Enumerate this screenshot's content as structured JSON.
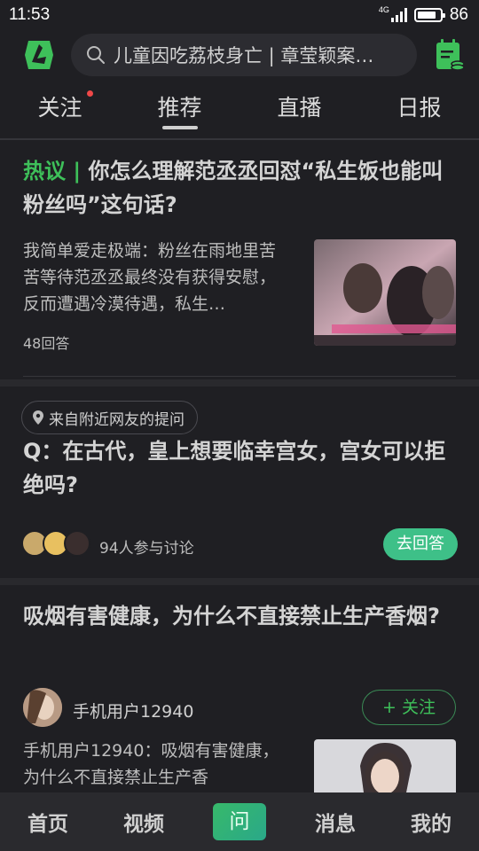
{
  "status_bar": {
    "time": "11:53",
    "network": "4G",
    "battery": "86",
    "battery_level": 0.86
  },
  "header": {
    "search_text": "儿童因吃荔枝身亡 | 章莹颖案…",
    "logo_icon": "app-logo-icon",
    "calendar_icon": "daily-calendar-icon"
  },
  "tabs": [
    {
      "label": "关注",
      "has_dot": true
    },
    {
      "label": "推荐",
      "active": true
    },
    {
      "label": "直播"
    },
    {
      "label": "日报"
    }
  ],
  "feed": {
    "card1": {
      "tag": "热议 | ",
      "title": "你怎么理解范丞丞回怼“私生饭也能叫粉丝吗”这句话?",
      "excerpt": "我简单爱走极端：粉丝在雨地里苦苦等待范丞丞最终没有获得安慰，反而遭遇冷漠待遇，私生…",
      "answers": "48回答"
    },
    "card2": {
      "location": "来自附近网友的提问",
      "title": "Q：在古代，皇上想要临幸宫女，宫女可以拒绝吗?",
      "participants": "94人参与讨论",
      "answer_button": "去回答"
    },
    "card3": {
      "title": "吸烟有害健康，为什么不直接禁止生产香烟?",
      "username": "手机用户12940",
      "follow_button": "+ 关注",
      "excerpt": "手机用户12940：吸烟有害健康，为什么不直接禁止生产香"
    }
  },
  "bottom_nav": [
    {
      "label": "首页"
    },
    {
      "label": "视频"
    },
    {
      "label": "问",
      "active": true
    },
    {
      "label": "消息"
    },
    {
      "label": "我的"
    }
  ],
  "colors": {
    "background": "#1f1f23",
    "accent_green": "#3ec05a",
    "answer_button": "#3ec088",
    "notification_dot": "#f04848"
  }
}
